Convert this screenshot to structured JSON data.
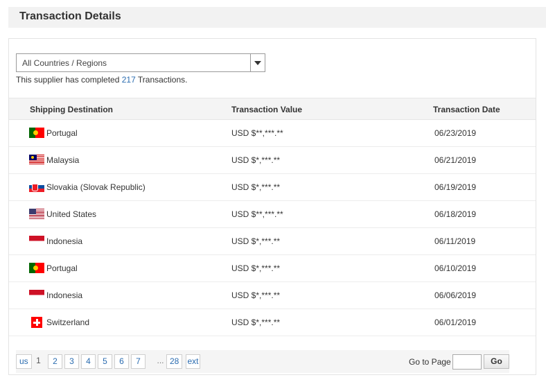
{
  "header": {
    "title": "Transaction Details"
  },
  "filter": {
    "selected": "All Countries / Regions"
  },
  "summary": {
    "prefix": "This supplier has completed ",
    "count": "217",
    "suffix": " Transactions."
  },
  "table": {
    "columns": [
      "Shipping Destination",
      "Transaction Value",
      "Transaction Date"
    ],
    "rows": [
      {
        "flag": "portugal-flag-icon",
        "country": "Portugal",
        "value": "USD $**,***.**",
        "date": "06/23/2019"
      },
      {
        "flag": "malaysia-flag-icon",
        "country": "Malaysia",
        "value": "USD $*,***.**",
        "date": "06/21/2019"
      },
      {
        "flag": "slovakia-flag-icon",
        "country": "Slovakia (Slovak Republic)",
        "value": "USD $*,***.**",
        "date": "06/19/2019"
      },
      {
        "flag": "united-states-flag-icon",
        "country": "United States",
        "value": "USD $**,***.**",
        "date": "06/18/2019"
      },
      {
        "flag": "indonesia-flag-icon",
        "country": "Indonesia",
        "value": "USD $*,***.**",
        "date": "06/11/2019"
      },
      {
        "flag": "portugal-flag-icon",
        "country": "Portugal",
        "value": "USD $*,***.**",
        "date": "06/10/2019"
      },
      {
        "flag": "indonesia-flag-icon",
        "country": "Indonesia",
        "value": "USD $*,***.**",
        "date": "06/06/2019"
      },
      {
        "flag": "switzerland-flag-icon",
        "country": "Switzerland",
        "value": "USD $*,***.**",
        "date": "06/01/2019"
      }
    ]
  },
  "pagination": {
    "prev_label": "us",
    "current": "1",
    "pages": [
      "2",
      "3",
      "4",
      "5",
      "6",
      "7"
    ],
    "ellipsis": "...",
    "last": "28",
    "next_label": "ext",
    "goto_label": "Go to Page",
    "goto_value": "",
    "go_label": "Go"
  },
  "colors": {
    "link": "#2b6cb0",
    "header_bg": "#f2f2f2",
    "table_head_bg": "#f4f4f4"
  }
}
